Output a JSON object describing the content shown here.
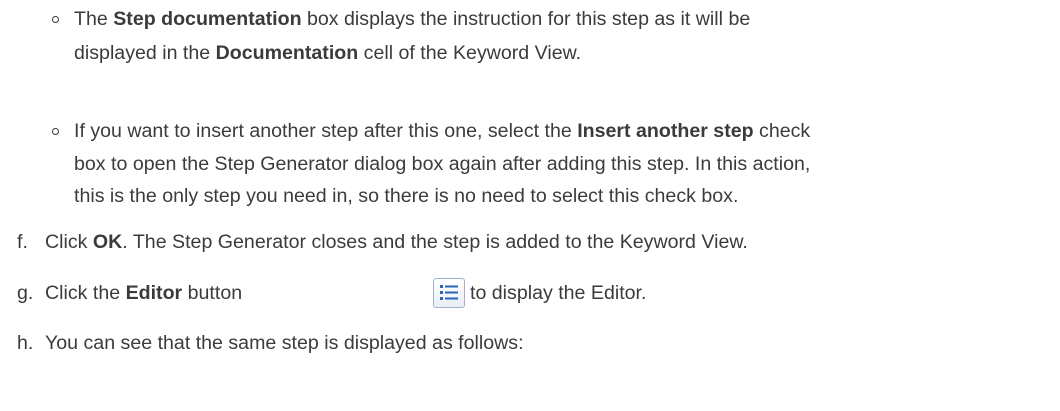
{
  "bullets": [
    {
      "lines": [
        [
          "The ",
          {
            "b": "Step documentation"
          },
          " box displays the instruction for this step as it will be"
        ],
        [
          "displayed in the ",
          {
            "b": "Documentation"
          },
          " cell of the Keyword View."
        ]
      ]
    },
    {
      "lines": [
        [
          "If you want to insert another step after this one, select the ",
          {
            "b": "Insert another step"
          },
          " check"
        ],
        [
          "box to open the Step Generator dialog box again after adding this step. In this action,"
        ],
        [
          "this is the only step you need in, so there is no need to select this check box."
        ]
      ]
    }
  ],
  "steps": [
    {
      "marker": "f.",
      "parts": [
        "Click ",
        {
          "b": "OK"
        },
        ". The Step Generator closes and the step is added to the Keyword View."
      ]
    },
    {
      "marker": "g.",
      "parts": [
        "Click the ",
        {
          "b": "Editor"
        },
        " button"
      ],
      "after_icon": "to display the Editor."
    },
    {
      "marker": "h.",
      "parts": [
        "You can see that the same step is displayed as follows:"
      ]
    }
  ],
  "icons": {
    "editor_button": "list-view-icon"
  }
}
